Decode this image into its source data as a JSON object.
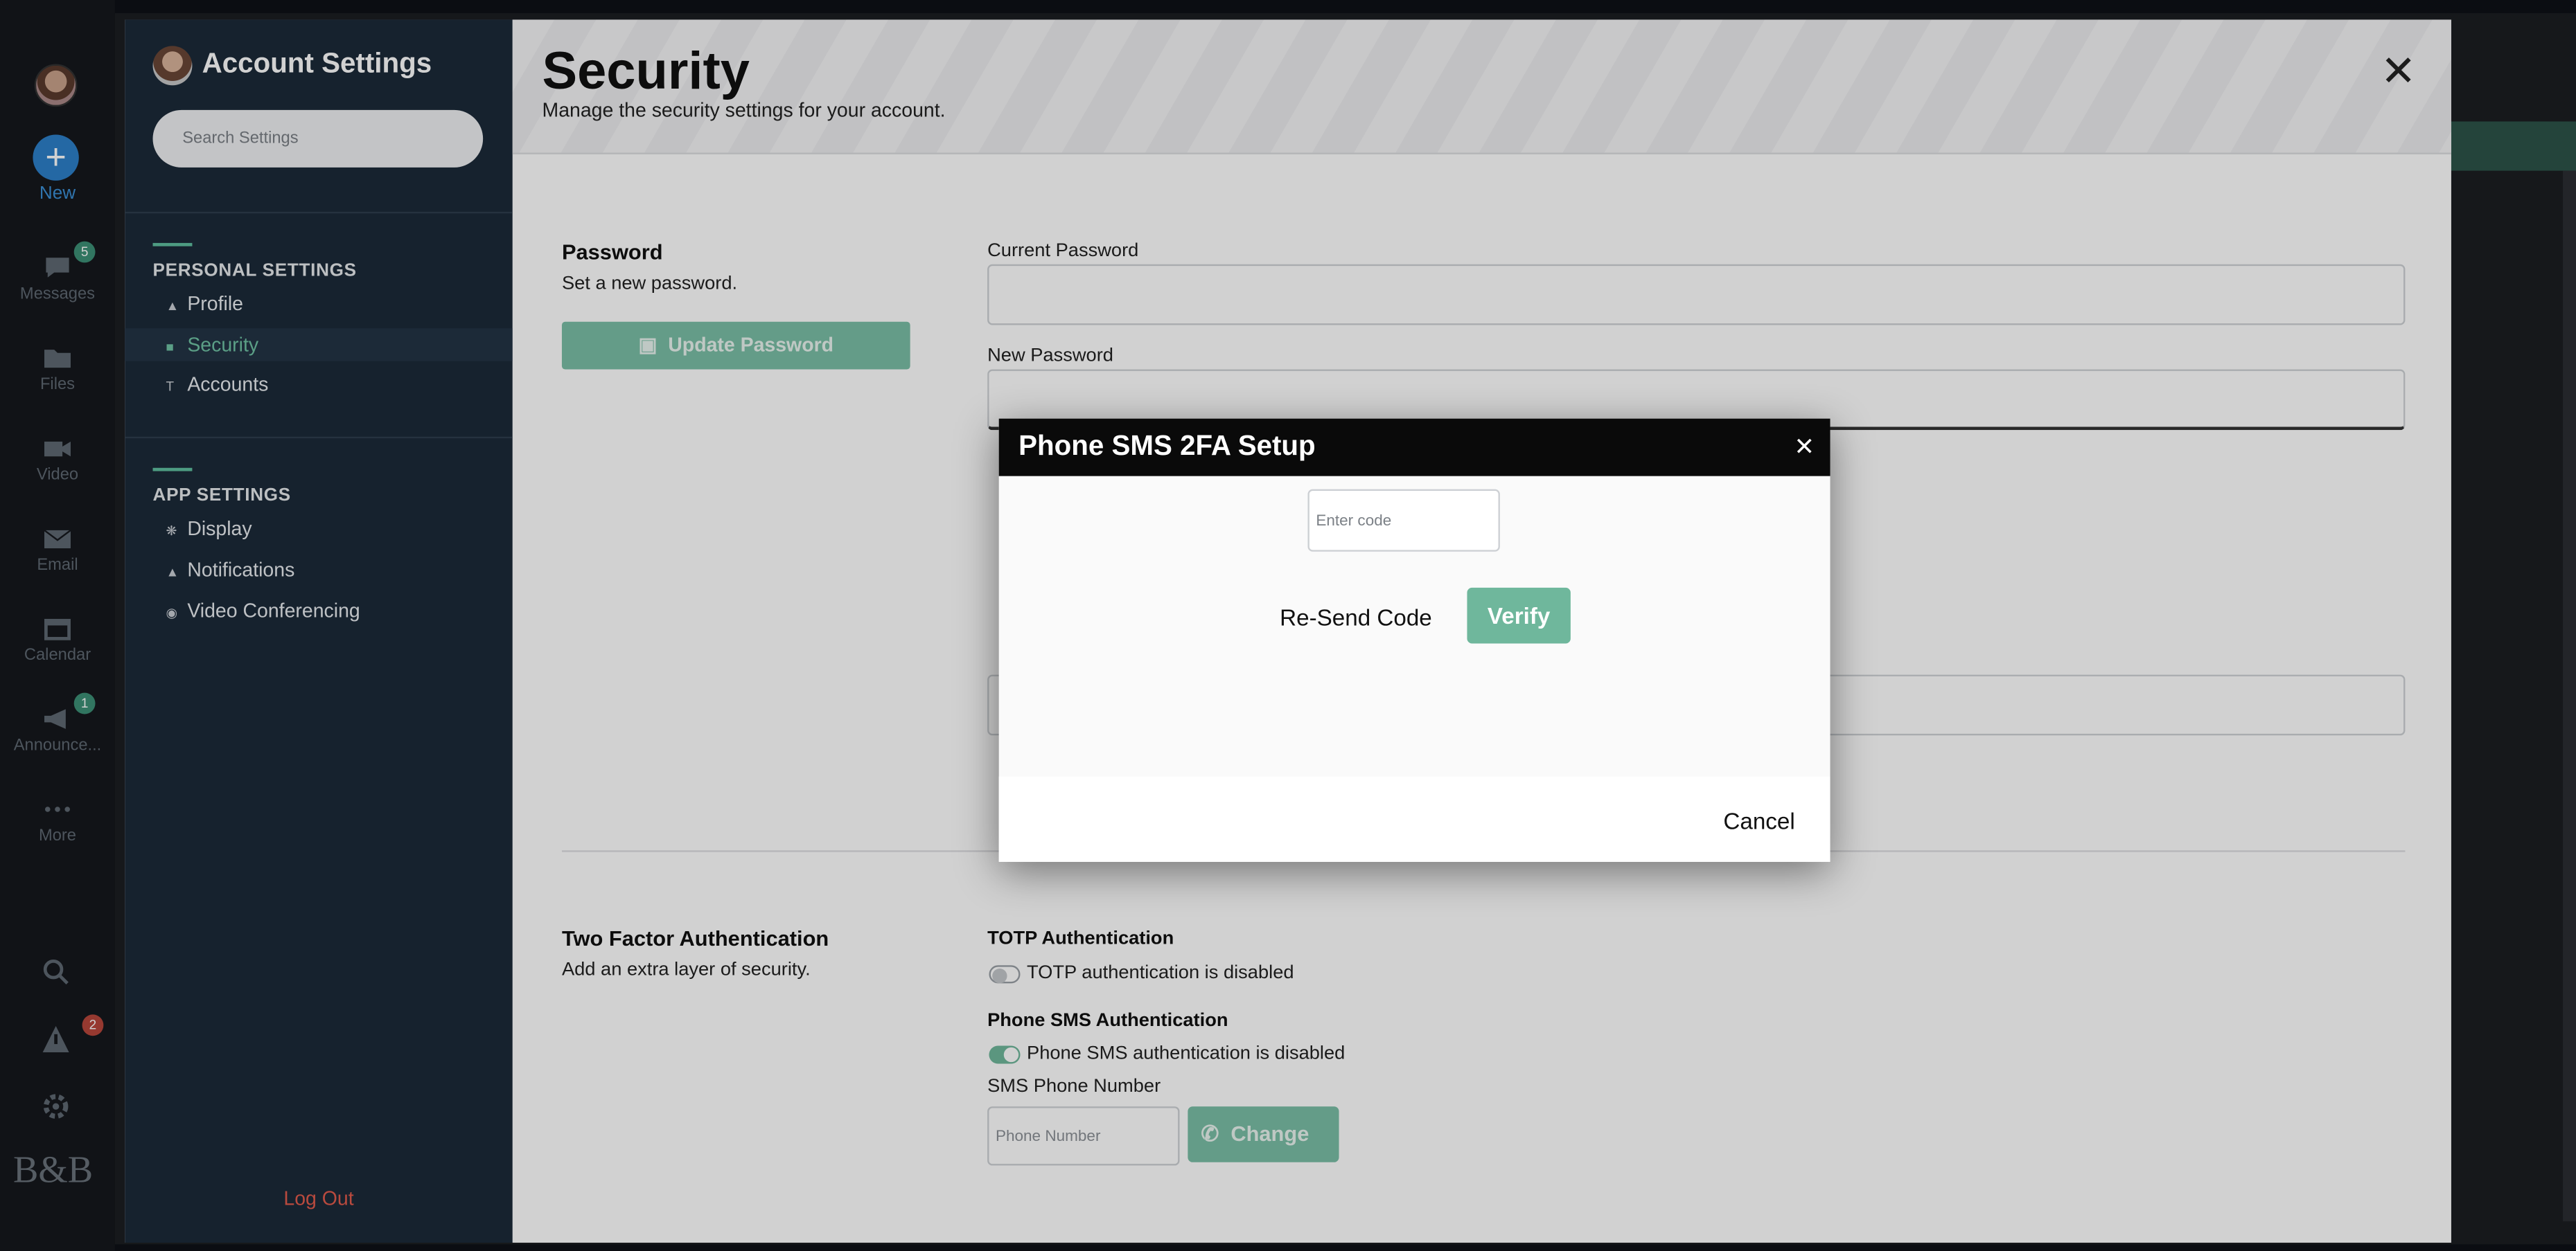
{
  "rail": {
    "new_label": "New",
    "items": [
      {
        "label": "Messages",
        "icon": "chat-icon",
        "badge": "5"
      },
      {
        "label": "Files",
        "icon": "folder-icon"
      },
      {
        "label": "Video",
        "icon": "video-icon"
      },
      {
        "label": "Email",
        "icon": "mail-icon"
      },
      {
        "label": "Calendar",
        "icon": "calendar-icon"
      },
      {
        "label": "Announce...",
        "icon": "megaphone-icon",
        "badge": "1"
      },
      {
        "label": "More",
        "icon": "more-icon"
      }
    ],
    "alert_badge": "2",
    "brand": "B&B"
  },
  "sidebar": {
    "title": "Account Settings",
    "search_placeholder": "Search Settings",
    "personal_heading": "PERSONAL SETTINGS",
    "personal_items": [
      "Profile",
      "Security",
      "Accounts"
    ],
    "app_heading": "APP SETTINGS",
    "app_items": [
      "Display",
      "Notifications",
      "Video Conferencing"
    ],
    "logout": "Log Out"
  },
  "main": {
    "title": "Security",
    "subtitle": "Manage the security settings for your account.",
    "password": {
      "title": "Password",
      "subtitle": "Set a new password.",
      "update_button": "Update Password",
      "current_label": "Current Password",
      "new_label": "New Password"
    },
    "two_factor": {
      "title": "Two Factor Authentication",
      "subtitle": "Add an extra layer of security.",
      "totp_heading": "TOTP Authentication",
      "totp_status": "TOTP authentication is disabled",
      "sms_heading": "Phone SMS Authentication",
      "sms_status": "Phone SMS authentication is disabled",
      "phone_label": "SMS Phone Number",
      "phone_placeholder": "Phone Number",
      "change_button": "Change"
    }
  },
  "modal": {
    "title": "Phone SMS 2FA Setup",
    "code_placeholder": "Enter code",
    "resend": "Re-Send Code",
    "verify": "Verify",
    "cancel": "Cancel"
  },
  "colors": {
    "accent_green": "#6fb79c",
    "sidebar_bg": "#1c2a39",
    "danger": "#e25b4c"
  }
}
